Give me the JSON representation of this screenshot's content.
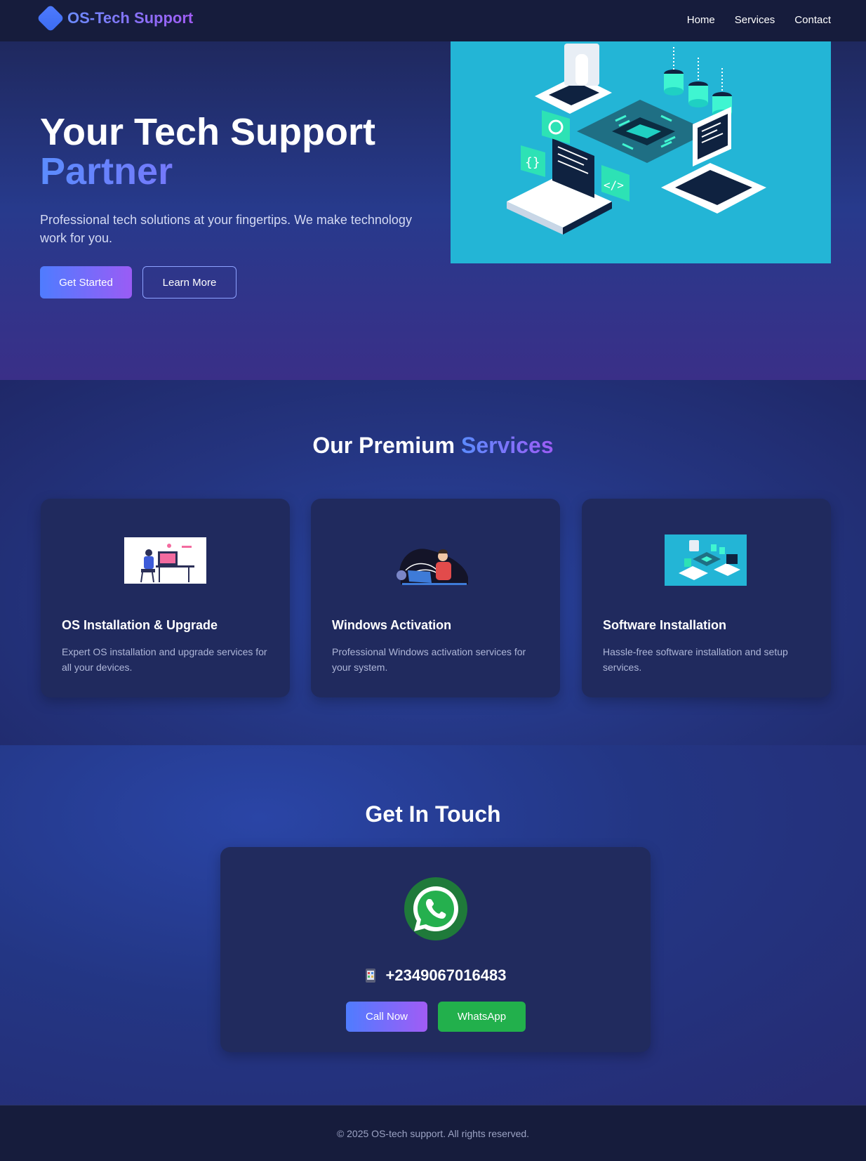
{
  "navbar": {
    "brand": "OS-Tech Support",
    "links": [
      "Home",
      "Services",
      "Contact"
    ]
  },
  "hero": {
    "title_line1": "Your Tech Support",
    "title_line2": "Partner",
    "subtitle": "Professional tech solutions at your fingertips. We make technology work for you.",
    "primary_button": "Get Started",
    "secondary_button": "Learn More"
  },
  "services": {
    "title_main": "Our Premium",
    "title_accent": "Services",
    "cards": [
      {
        "title": "OS Installation & Upgrade",
        "description": "Expert OS installation and upgrade services for all your devices.",
        "icon": "developer-at-desk-illustration"
      },
      {
        "title": "Windows Activation",
        "description": "Professional Windows activation services for your system.",
        "icon": "person-with-laptop-illustration"
      },
      {
        "title": "Software Installation",
        "description": "Hassle-free software installation and setup services.",
        "icon": "isometric-tech-illustration"
      }
    ]
  },
  "contact": {
    "title": "Get In Touch",
    "phone": "+2349067016483",
    "call_button": "Call Now",
    "whatsapp_button": "WhatsApp"
  },
  "footer": {
    "text": "© 2025 OS-tech support. All rights reserved."
  },
  "colors": {
    "accent_blue": "#5b8cff",
    "accent_purple": "#9d5cf5",
    "whatsapp_green": "#22b04c",
    "hero_image_bg": "#23b5d6"
  }
}
